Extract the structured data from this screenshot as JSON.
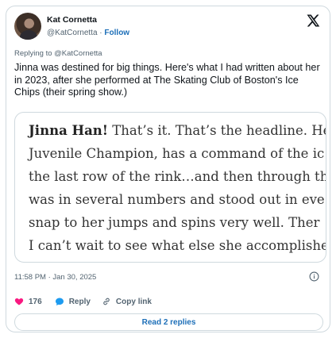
{
  "author": {
    "name": "Kat Cornetta",
    "handle": "@KatCornetta",
    "separator": "·",
    "follow_label": "Follow"
  },
  "replying_to": "Replying to @KatCornetta",
  "tweet_text": "Jinna was destined for big things. Here's what I had written about her in 2023, after she performed at The Skating Club of Boston's Ice Chips (their spring show.)",
  "quote_image": {
    "lines": [
      {
        "bold": "Jinna Han!",
        "rest": " That’s it. That’s the headline. He"
      },
      {
        "bold": "",
        "rest": "Juvenile Champion, has a command of the ic"
      },
      {
        "bold": "",
        "rest": "the last row of the rink…and then through th"
      },
      {
        "bold": "",
        "rest": "was in several numbers and stood out in eve"
      },
      {
        "bold": "",
        "rest": "snap to her jumps and spins very well. Ther"
      },
      {
        "bold": "",
        "rest": "I can’t wait to see what else she accomplishe"
      }
    ]
  },
  "timestamp": "11:58 PM · Jan 30, 2025",
  "actions": {
    "likes_count": "176",
    "reply_label": "Reply",
    "copy_link_label": "Copy link"
  },
  "read_replies_label": "Read 2 replies",
  "colors": {
    "link": "#1d6fb8",
    "like": "#f91880",
    "reply": "#1d9bf0",
    "secondary_text": "#536471"
  }
}
